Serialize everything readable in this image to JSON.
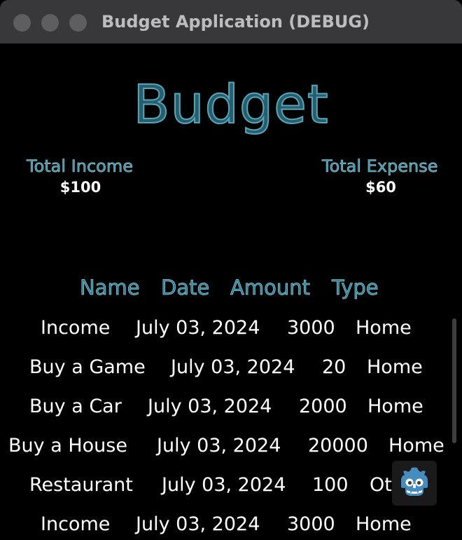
{
  "window": {
    "title": "Budget Application (DEBUG)"
  },
  "app": {
    "title": "Budget",
    "income": {
      "label": "Total Income",
      "value": "$100"
    },
    "expense": {
      "label": "Total Expense",
      "value": "$60"
    }
  },
  "table": {
    "headers": [
      "Name",
      "Date",
      "Amount",
      "Type"
    ],
    "rows": [
      [
        "Income",
        "July 03, 2024",
        "3000",
        "Home"
      ],
      [
        "Buy a Game",
        "July 03, 2024",
        "20",
        "Home"
      ],
      [
        "Buy a Car",
        "July 03, 2024",
        "2000",
        "Home"
      ],
      [
        "Buy a House",
        "July 03, 2024",
        "20000",
        "Home"
      ],
      [
        "Restaurant",
        "July 03, 2024",
        "100",
        "Ot"
      ],
      [
        "Income",
        "July 03, 2024",
        "3000",
        "Home"
      ]
    ]
  },
  "overlay": {
    "icon": "godot-logo-icon"
  },
  "colors": {
    "title_fill": "#255f6f",
    "title_outline": "#5aa4b8",
    "label_color": "#3f8ea3",
    "background": "#000000",
    "titlebar": "#38383a"
  }
}
